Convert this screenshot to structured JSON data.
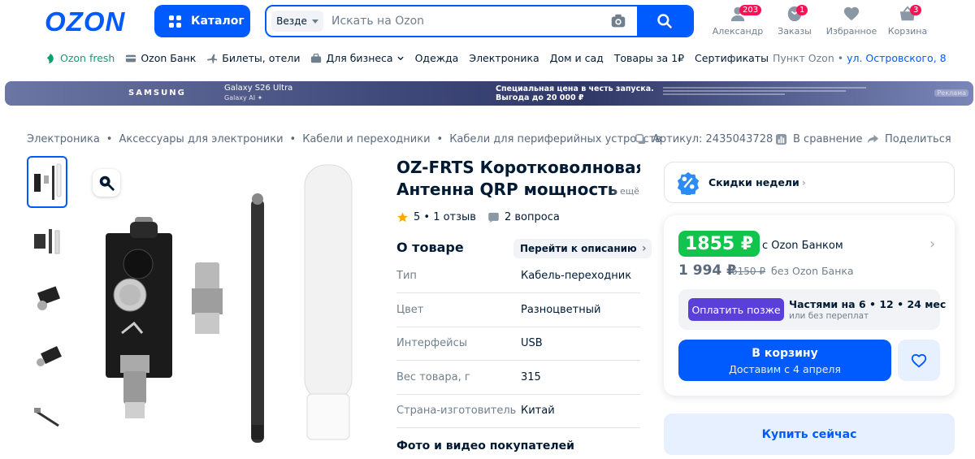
{
  "header": {
    "logo": "OZON",
    "catalog_label": "Каталог",
    "search_scope": "Везде",
    "search_placeholder": "Искать на Ozon",
    "icons": [
      {
        "label": "Александр",
        "badge": "203"
      },
      {
        "label": "Заказы",
        "badge": "1"
      },
      {
        "label": "Избранное",
        "badge": ""
      },
      {
        "label": "Корзина",
        "badge": "3"
      }
    ]
  },
  "nav": {
    "items": [
      "Ozon fresh",
      "Ozon Банк",
      "Билеты, отели",
      "Для бизнеса",
      "Одежда",
      "Электроника",
      "Дом и сад",
      "Товары за 1₽",
      "Сертификаты"
    ],
    "pickup_label": "Пункт Ozon •",
    "pickup_address": "ул. Островского, 8"
  },
  "banner": {
    "brand": "SAMSUNG",
    "model": "Galaxy S26 Ultra",
    "model_sub": "Galaxy AI ✦",
    "promo_line1": "Специальная цена в честь запуска.",
    "promo_line2": "Выгода до 20 000 ₽",
    "ad_label": "Реклама"
  },
  "breadcrumbs": [
    "Электроника",
    "Аксессуары для электроники",
    "Кабели и переходники",
    "Кабели для периферийных устройств"
  ],
  "meta": {
    "article": "Артикул: 2435043728",
    "compare": "В сравнение",
    "share": "Поделиться"
  },
  "product": {
    "title_line1": "OZ-FRTS Коротковолновая",
    "title_line2": "Антенна QRP мощность",
    "more": "ещё",
    "rating": "5 • 1 отзыв",
    "questions": "2 вопроса",
    "about_heading": "О товаре",
    "to_description": "Перейти к описанию",
    "specs": [
      {
        "k": "Тип",
        "v": "Кабель-переходник"
      },
      {
        "k": "Цвет",
        "v": "Разноцветный"
      },
      {
        "k": "Интерфейсы",
        "v": "USB"
      },
      {
        "k": "Вес товара, г",
        "v": "315"
      },
      {
        "k": "Страна-изготовитель",
        "v": "Китай"
      }
    ],
    "photos_heading": "Фото и видео покупателей"
  },
  "purchase": {
    "week_discounts": "Скидки недели",
    "price_card": "1855 ₽",
    "with_card": "с Ozon Банком",
    "price_full": "1 994 ₽",
    "price_old": "6150 ₽",
    "without_card": "без Ozon Банка",
    "pay_later": "Оплатить позже",
    "installments_title": "Частями на 6 • 12 • 24 мес",
    "installments_sub": "или без переплат",
    "cart_label": "В корзину",
    "cart_delivery": "Доставим с 4 апреля",
    "buy_now": "Купить сейчас"
  },
  "colors": {
    "brand": "#005bff",
    "green_price": "#10c44c",
    "pay_later": "#5a3fd9",
    "badge": "#f91155"
  }
}
